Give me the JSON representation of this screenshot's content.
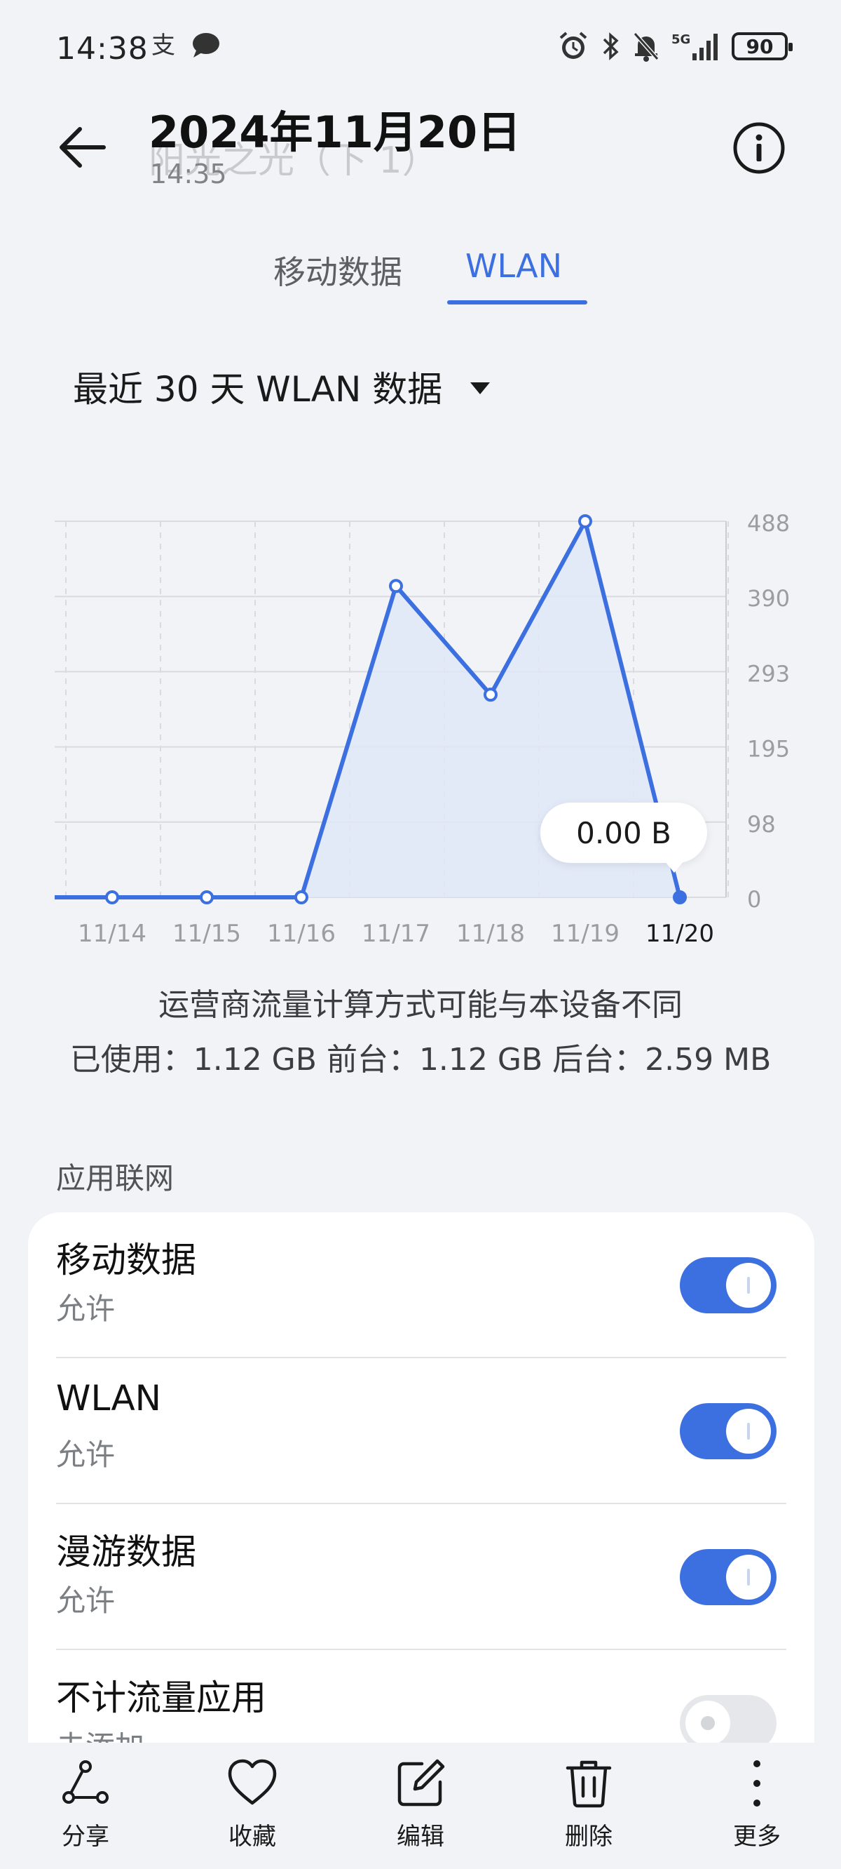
{
  "status_bar": {
    "time": "14:38",
    "battery": "90",
    "network": "5G"
  },
  "header": {
    "title": "2024年11月20日",
    "ghost_text": "阳光之光（下 1）",
    "subtitle": "14:35"
  },
  "tabs": [
    {
      "label": "移动数据",
      "active": false
    },
    {
      "label": "WLAN",
      "active": true
    }
  ],
  "period_dropdown": {
    "label": "最近 30 天 WLAN 数据"
  },
  "chart_data": {
    "type": "area",
    "categories": [
      "11/14",
      "11/15",
      "11/16",
      "11/17",
      "11/18",
      "11/19",
      "11/20"
    ],
    "values": [
      0,
      0,
      0,
      404,
      263,
      488,
      0
    ],
    "yticks": [
      "488",
      "390",
      "293",
      "195",
      "98",
      "0"
    ],
    "ylim": [
      0,
      488
    ],
    "selected_index": 6,
    "tooltip": "0.00 B",
    "grid": true,
    "colors": {
      "line": "#3c6fe0",
      "fill": "#dfe6f7",
      "grid": "#d9dbe0"
    }
  },
  "summary": {
    "note": "运营商流量计算方式可能与本设备不同",
    "usage": "已使用：1.12 GB 前台：1.12 GB 后台：2.59 MB"
  },
  "section": {
    "label": "应用联网",
    "rows": [
      {
        "title": "移动数据",
        "subtitle": "允许",
        "enabled": true
      },
      {
        "title": "WLAN",
        "subtitle": "允许",
        "enabled": true
      },
      {
        "title": "漫游数据",
        "subtitle": "允许",
        "enabled": true
      },
      {
        "title": "不计流量应用",
        "subtitle": "未添加",
        "enabled": false
      }
    ]
  },
  "bottom_bar": {
    "items": [
      {
        "label": "分享",
        "icon": "share-icon"
      },
      {
        "label": "收藏",
        "icon": "heart-icon"
      },
      {
        "label": "编辑",
        "icon": "edit-icon"
      },
      {
        "label": "删除",
        "icon": "trash-icon"
      },
      {
        "label": "更多",
        "icon": "more-icon"
      }
    ]
  },
  "accent_color": "#3c6fe0"
}
